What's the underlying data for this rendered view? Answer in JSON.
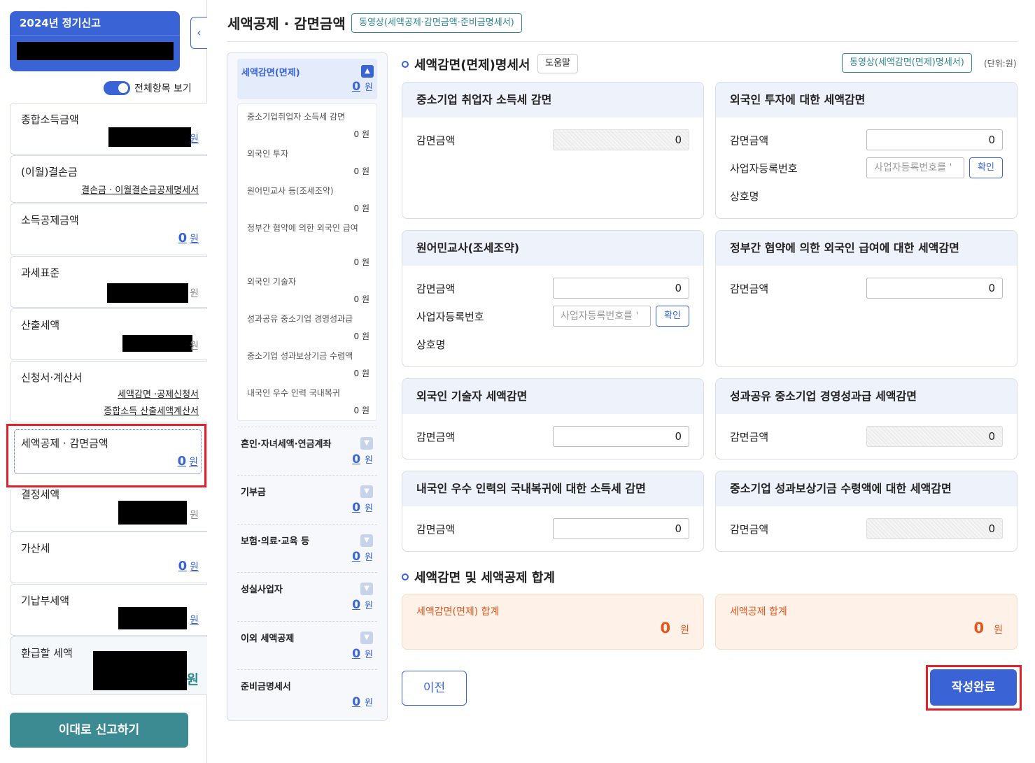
{
  "sidebar": {
    "year_title": "2024년 정기신고",
    "toggle_label": "전체항목 보기",
    "unit": "원",
    "items": [
      {
        "label": "종합소득금액"
      },
      {
        "label": "(이월)결손금",
        "link": "결손금 · 이월결손금공제명세서"
      },
      {
        "label": "소득공제금액",
        "value": "0"
      },
      {
        "label": "과세표준"
      },
      {
        "label": "산출세액"
      },
      {
        "label": "신청서·계산서",
        "links": [
          "세액감면 ·공제신청서",
          "종합소득 산출세액계산서"
        ]
      },
      {
        "label": "세액공제 · 감면금액",
        "value": "0"
      },
      {
        "label": "결정세액"
      },
      {
        "label": "가산세",
        "value": "0"
      },
      {
        "label": "기납부세액"
      },
      {
        "label": "환급할 세액"
      }
    ],
    "submit_label": "이대로 신고하기"
  },
  "header": {
    "title": "세액공제 · 감면금액",
    "video_label": "동영상(세액공제·감면금액·준비금명세서)"
  },
  "midnav": {
    "unit": "원",
    "selected": {
      "label": "세액감면(면제)",
      "value": "0"
    },
    "sub_items": [
      {
        "label": "중소기업취업자 소득세 감면",
        "value": "0 원"
      },
      {
        "label": "외국인 투자",
        "value": "0 원"
      },
      {
        "label": "원어민교사 등(조세조약)",
        "value": "0 원"
      },
      {
        "label": "정부간 협약에 의한 외국인 급여",
        "value": "0 원"
      },
      {
        "label": "외국인 기술자",
        "value": "0 원"
      },
      {
        "label": "성과공유 중소기업 경영성과급",
        "value": "0 원"
      },
      {
        "label": "중소기업 성과보상기금 수령액",
        "value": "0 원"
      },
      {
        "label": "내국인 우수 인력 국내복귀",
        "value": "0 원"
      }
    ],
    "groups": [
      {
        "label": "혼인·자녀세액·연금계좌",
        "value": "0"
      },
      {
        "label": "기부금",
        "value": "0"
      },
      {
        "label": "보험·의료·교육 등",
        "value": "0"
      },
      {
        "label": "성실사업자",
        "value": "0"
      },
      {
        "label": "이외 세액공제",
        "value": "0"
      },
      {
        "label": "준비금명세서",
        "value": "0"
      }
    ]
  },
  "main": {
    "section1_title": "세액감면(면제)명세서",
    "help_label": "도움말",
    "video_label": "동영상(세액감면(면제)명세서)",
    "unit_note": "(단위:원)",
    "field_amount": "감면금액",
    "field_regno": "사업자등록번호",
    "field_company": "상호명",
    "regno_placeholder": "사업자등록번호를 '",
    "confirm_label": "확인",
    "cards": [
      {
        "title": "중소기업 취업자 소득세 감면",
        "amount": "0"
      },
      {
        "title": "외국인 투자에 대한 세액감면",
        "amount": "0"
      },
      {
        "title": "원어민교사(조세조약)",
        "amount": "0"
      },
      {
        "title": "정부간 협약에 의한 외국인 급여에 대한 세액감면",
        "amount": "0"
      },
      {
        "title": "외국인 기술자 세액감면",
        "amount": "0"
      },
      {
        "title": "성과공유 중소기업 경영성과급 세액감면",
        "amount": "0"
      },
      {
        "title": "내국인 우수 인력의 국내복귀에 대한 소득세 감면",
        "amount": "0"
      },
      {
        "title": "중소기업 성과보상기금 수령액에 대한  세액감면",
        "amount": "0"
      }
    ],
    "section2_title": "세액감면 및 세액공제 합계",
    "sums": [
      {
        "label": "세액감면(면제) 합계",
        "value": "0",
        "unit": "원"
      },
      {
        "label": "세액공제 합계",
        "value": "0",
        "unit": "원"
      }
    ],
    "prev_label": "이전",
    "done_label": "작성완료"
  }
}
